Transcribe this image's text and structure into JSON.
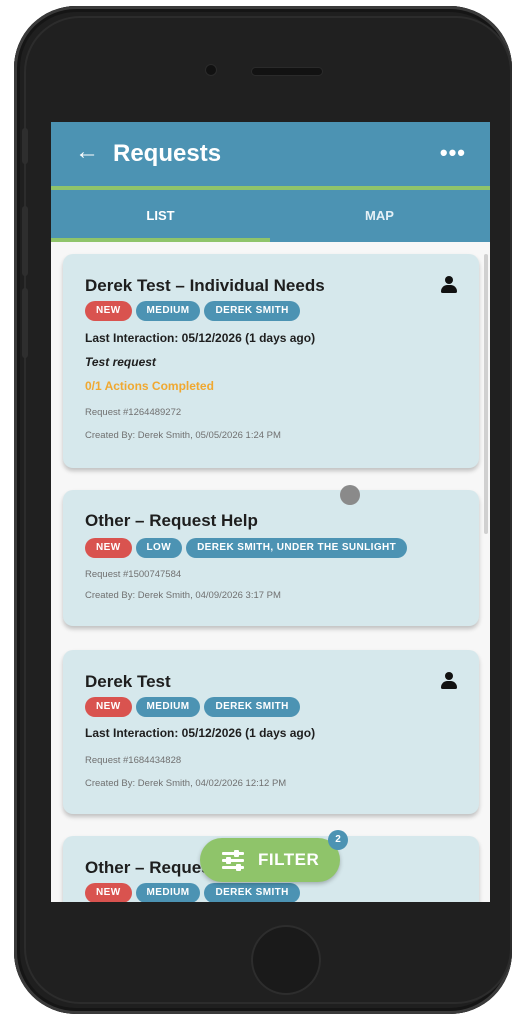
{
  "header": {
    "title": "Requests",
    "back_icon": "arrow-left-icon",
    "more_icon": "more-horizontal-icon"
  },
  "tabs": [
    {
      "label": "LIST",
      "active": true
    },
    {
      "label": "MAP",
      "active": false
    }
  ],
  "requests": [
    {
      "title": "Derek Test – Individual Needs",
      "badges": [
        "NEW",
        "MEDIUM",
        "DEREK SMITH"
      ],
      "last_interaction": "Last Interaction: 05/12/2026 (1 days ago)",
      "description": "Test request",
      "actions": "0/1 Actions Completed",
      "request_no": "Request #1264489272",
      "created": "Created By: Derek Smith, 05/05/2026 1:24 PM"
    },
    {
      "title": "Other – Request Help",
      "badges": [
        "NEW",
        "LOW",
        "DEREK SMITH, UNDER THE SUNLIGHT"
      ],
      "request_no": "Request #1500747584",
      "created": "Created By: Derek Smith, 04/09/2026 3:17 PM"
    },
    {
      "title": "Derek Test",
      "badges": [
        "NEW",
        "MEDIUM",
        "DEREK SMITH"
      ],
      "last_interaction": "Last Interaction: 05/12/2026 (1 days ago)",
      "request_no": "Request #1684434828",
      "created": "Created By: Derek Smith, 04/02/2026 12:12 PM"
    },
    {
      "title": "Other – Reques",
      "badges": [
        "NEW",
        "MEDIUM",
        "DEREK SMITH"
      ]
    }
  ],
  "filter": {
    "label": "FILTER",
    "count": "2",
    "icon": "sliders-icon"
  },
  "colors": {
    "primary": "#4c93b3",
    "accent_green": "#8fc46a",
    "badge_new": "#d9534f",
    "card_bg": "#d6e8ec",
    "actions_orange": "#f0a830"
  }
}
